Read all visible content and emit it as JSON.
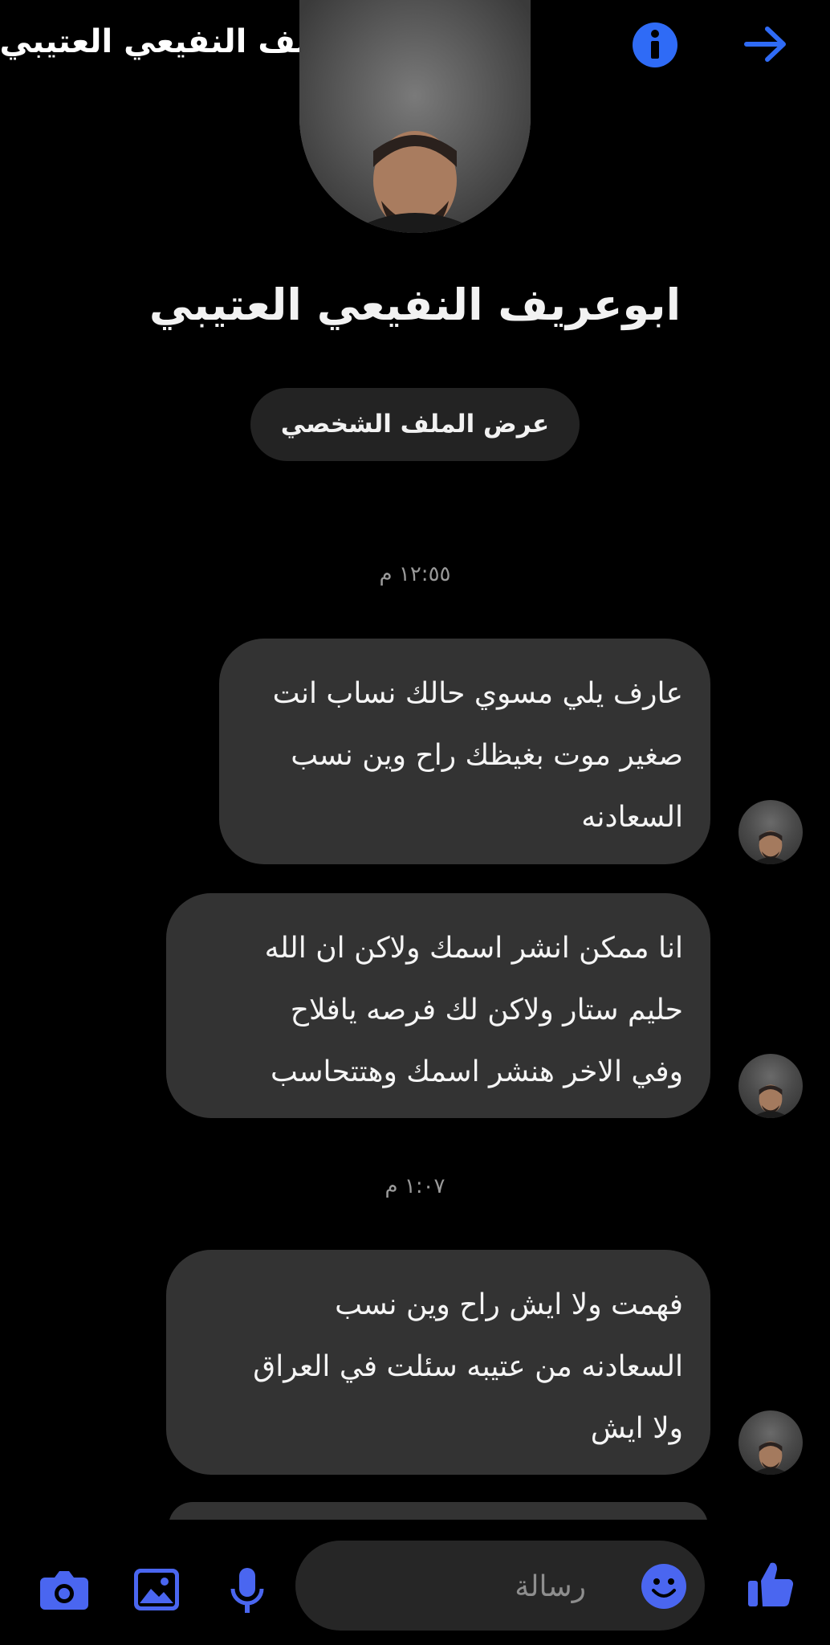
{
  "header": {
    "contact_name": "ابوعريف النفيعي العتيبي",
    "icons": {
      "back": "arrow-right-icon",
      "info": "info-icon"
    }
  },
  "profile": {
    "name": "ابوعريف النفيعي العتيبي",
    "view_profile_label": "عرض الملف الشخصي"
  },
  "conversation": [
    {
      "type": "timestamp",
      "text": "١٢:٥٥ م"
    },
    {
      "type": "message",
      "lines": [
        "عارف يلي مسوي حالك نساب انت",
        "صغير موت بغيظك راح وين نسب",
        "السعادنه"
      ]
    },
    {
      "type": "message",
      "lines": [
        "انا ممكن انشر اسمك ولاكن ان الله",
        "حليم ستار ولاكن لك فرصه يافلاح",
        "وفي الاخر هنشر اسمك وهتتحاسب"
      ]
    },
    {
      "type": "timestamp",
      "text": "١:٠٧ م"
    },
    {
      "type": "message",
      "lines": [
        "فهمت ولا ايش راح وين نسب",
        "السعادنه من عتيبه سئلت في العراق",
        "ولا ايش"
      ]
    }
  ],
  "composer": {
    "placeholder": "رسالة"
  },
  "toolbar_icons": [
    "camera-icon",
    "gallery-icon",
    "microphone-icon",
    "emoji-icon",
    "thumbs-up-icon"
  ],
  "colors": {
    "background": "#000000",
    "bubble": "#333333",
    "accent": "#2F6BF6",
    "bottom_icons": "#4A66F0"
  }
}
